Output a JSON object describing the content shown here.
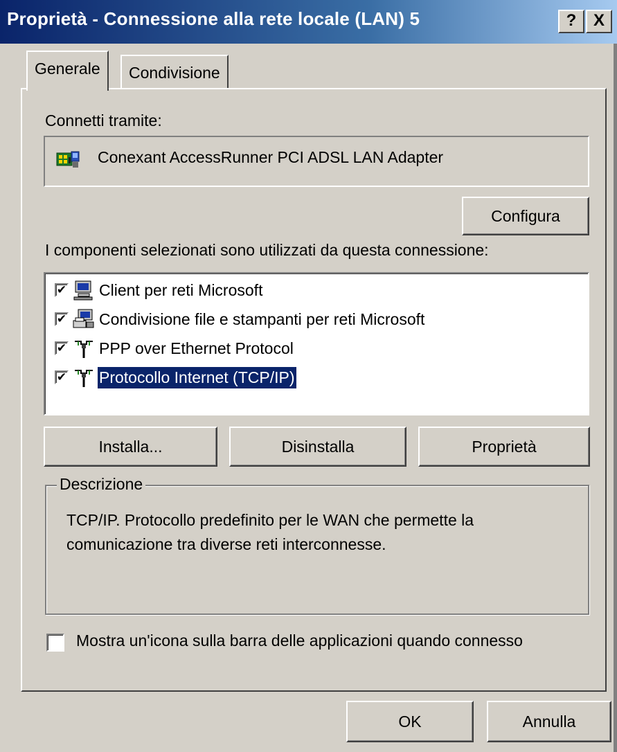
{
  "window": {
    "title": "Proprietà - Connessione alla rete locale (LAN) 5",
    "help_label": "?",
    "close_label": "X"
  },
  "tabs": [
    {
      "label": "Generale",
      "active": true
    },
    {
      "label": "Condivisione",
      "active": false
    }
  ],
  "connect_via": {
    "label": "Connetti tramite:",
    "adapter_name": "Conexant AccessRunner PCI ADSL LAN Adapter",
    "adapter_icon": "network-adapter-icon",
    "configure_label": "Configura"
  },
  "components": {
    "label": "I componenti selezionati sono utilizzati da questa connessione:",
    "items": [
      {
        "label": "Client per reti Microsoft",
        "checked": true,
        "icon": "network-client-icon",
        "selected": false
      },
      {
        "label": "Condivisione file e stampanti per reti Microsoft",
        "checked": true,
        "icon": "file-printer-sharing-icon",
        "selected": false
      },
      {
        "label": "PPP over Ethernet Protocol",
        "checked": true,
        "icon": "protocol-icon",
        "selected": false
      },
      {
        "label": "Protocollo Internet (TCP/IP)",
        "checked": true,
        "icon": "protocol-icon",
        "selected": true
      }
    ],
    "install_label": "Installa...",
    "uninstall_label": "Disinstalla",
    "properties_label": "Proprietà"
  },
  "description": {
    "legend": "Descrizione",
    "text": "TCP/IP. Protocollo predefinito per le WAN che permette la comunicazione tra diverse reti interconnesse."
  },
  "show_icon": {
    "label": "Mostra un'icona sulla barra delle applicazioni quando connesso",
    "checked": false
  },
  "footer": {
    "ok_label": "OK",
    "cancel_label": "Annulla"
  },
  "colors": {
    "title_gradient_start": "#0a246a",
    "title_gradient_end": "#a6caf0",
    "face": "#d4d0c8",
    "selection": "#0a246a"
  }
}
